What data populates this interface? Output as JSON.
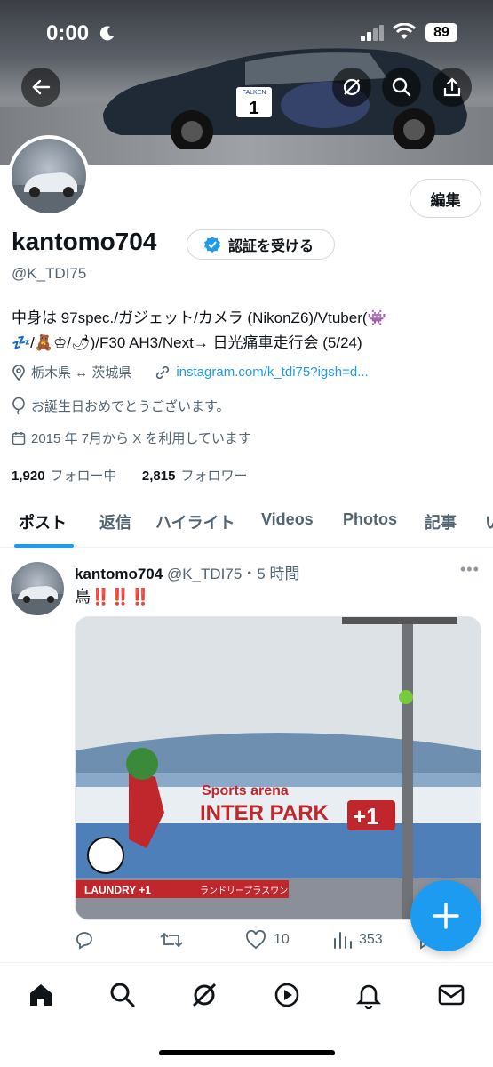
{
  "status_bar": {
    "time": "0:00",
    "battery": "89"
  },
  "profile": {
    "display_name": "kantomo704",
    "handle": "@K_TDI75",
    "edit_label": "編集",
    "verify_label": "認証を受ける",
    "bio_line1": "中身は 97spec./ガジェット/カメラ (NikonZ6)/Vtuber(👾",
    "bio_line2": "💤/🧸♔/🌶)/F30 AH3/Next→ 日光痛車走行会 (5/24)",
    "location": "栃木県 ↔ 茨城県",
    "link": "instagram.com/k_tdi75?igsh=d...",
    "birthday": "お誕生日おめでとうございます。",
    "joined": "2015 年 7月から X を利用しています",
    "following_count": "1,920",
    "following_label": "フォロー中",
    "followers_count": "2,815",
    "followers_label": "フォロワー"
  },
  "tabs": [
    "ポスト",
    "返信",
    "ハイライト",
    "Videos",
    "Photos",
    "記事",
    "い"
  ],
  "post": {
    "author": "kantomo704",
    "meta": "@K_TDI75・5 時間",
    "text": "鳥",
    "bangs": "‼️‼️‼️",
    "image_text_top": "Sports arena",
    "image_text_main": "INTER PARK",
    "image_text_plus": "+1",
    "image_text_laundry": "LAUNDRY +1",
    "image_text_laundry_jp": "ランドリープラスワン",
    "likes": "10",
    "views": "353"
  },
  "banner": {
    "number_plate": "1",
    "plate_brand": "FALKEN"
  },
  "colors": {
    "accent": "#1d9bf0",
    "verified": "#1d9bf0",
    "bang": "#e0245e"
  },
  "icons": [
    "back-arrow-icon",
    "grok-icon",
    "search-icon",
    "share-icon",
    "verified-badge-icon",
    "location-icon",
    "link-icon",
    "balloon-icon",
    "calendar-icon",
    "reply-icon",
    "repost-icon",
    "like-icon",
    "views-icon",
    "bookmark-icon",
    "compose-icon",
    "home-icon",
    "explore-icon",
    "grok-nav-icon",
    "video-icon",
    "notifications-icon",
    "messages-icon"
  ]
}
